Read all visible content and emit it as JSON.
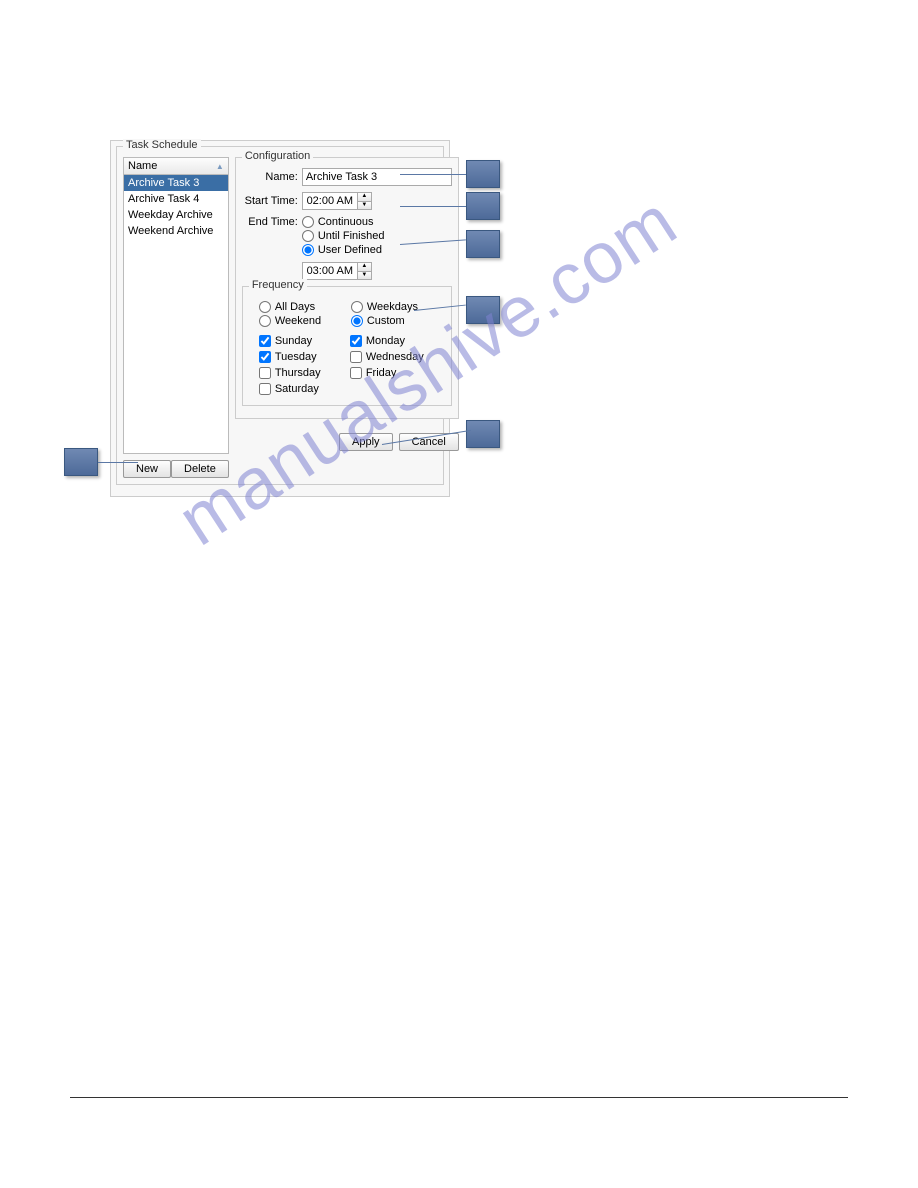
{
  "taskSchedule": {
    "title": "Task Schedule",
    "listHeader": "Name",
    "items": [
      {
        "label": "Archive Task 3",
        "selected": true
      },
      {
        "label": "Archive Task 4",
        "selected": false
      },
      {
        "label": "Weekday Archive",
        "selected": false
      },
      {
        "label": "Weekend Archive",
        "selected": false
      }
    ],
    "newBtn": "New",
    "deleteBtn": "Delete"
  },
  "config": {
    "title": "Configuration",
    "nameLabel": "Name:",
    "nameValue": "Archive Task 3",
    "startLabel": "Start Time:",
    "startValue": "02:00 AM",
    "endLabel": "End Time:",
    "endOptions": {
      "continuous": "Continuous",
      "untilFinished": "Until Finished",
      "userDefined": "User Defined"
    },
    "endSelected": "userDefined",
    "endValue": "03:00 AM"
  },
  "frequency": {
    "title": "Frequency",
    "options": {
      "allDays": "All Days",
      "weekdays": "Weekdays",
      "weekend": "Weekend",
      "custom": "Custom"
    },
    "selected": "custom",
    "days": [
      {
        "label": "Sunday",
        "checked": true
      },
      {
        "label": "Monday",
        "checked": true
      },
      {
        "label": "Tuesday",
        "checked": true
      },
      {
        "label": "Wednesday",
        "checked": false
      },
      {
        "label": "Thursday",
        "checked": false
      },
      {
        "label": "Friday",
        "checked": false
      },
      {
        "label": "Saturday",
        "checked": false
      }
    ]
  },
  "actions": {
    "apply": "Apply",
    "cancel": "Cancel"
  },
  "watermark": "manualshive.com"
}
